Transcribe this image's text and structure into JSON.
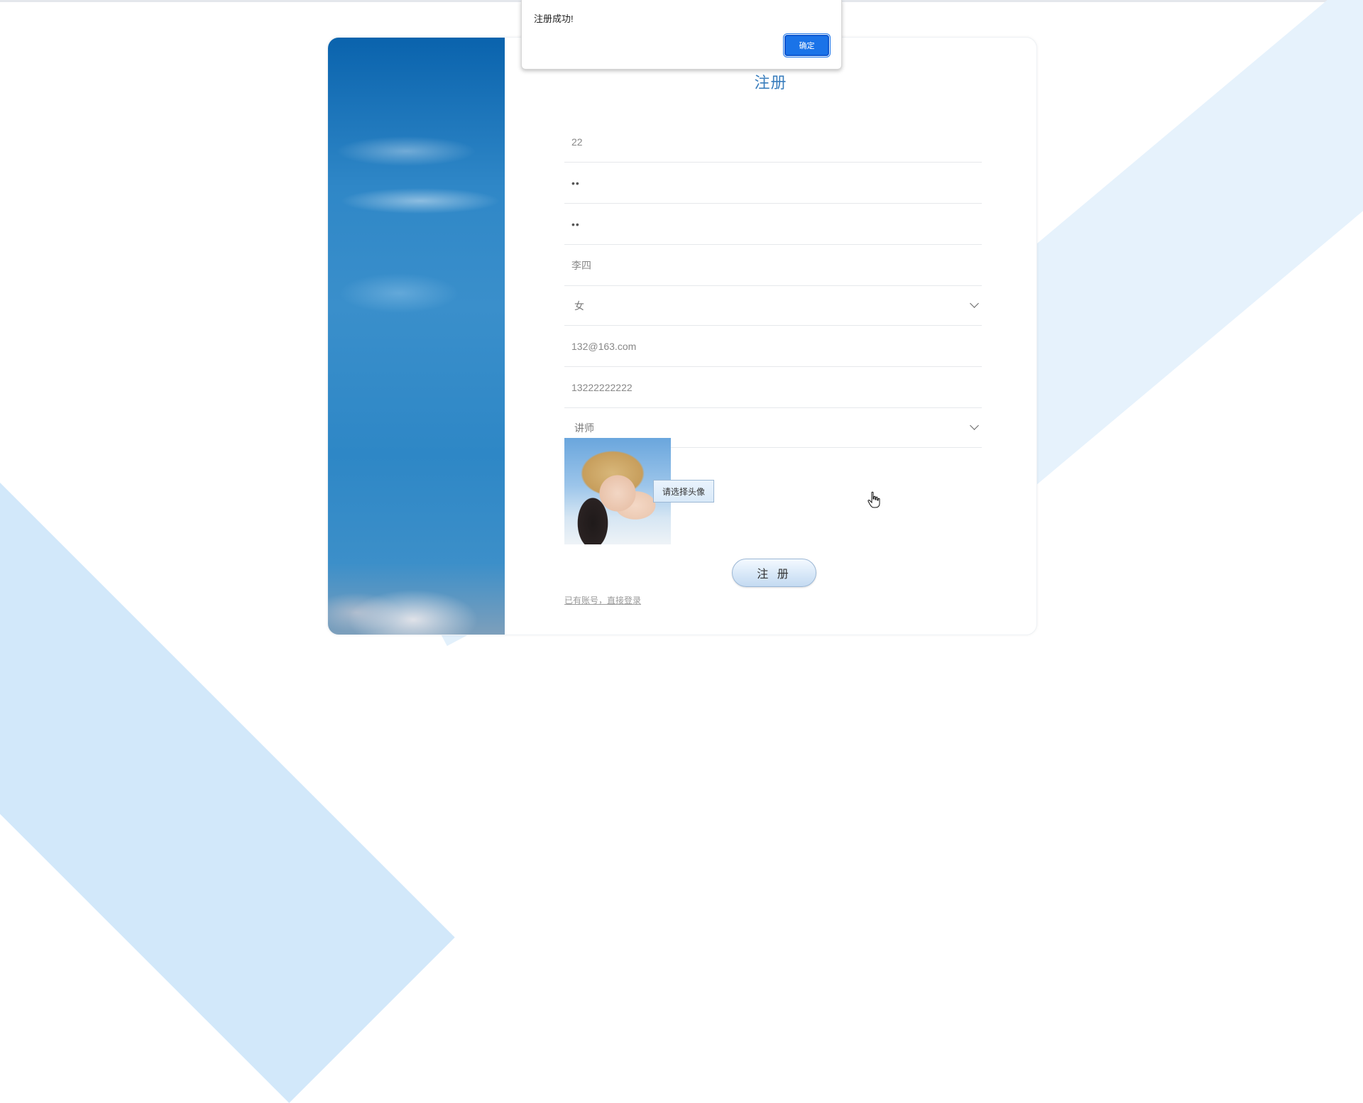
{
  "alert": {
    "message": "注册成功!",
    "ok_label": "确定"
  },
  "form": {
    "title": "注册",
    "username_value": "22",
    "password_value": "••",
    "confirm_password_value": "••",
    "realname_value": "李四",
    "gender": {
      "selected": "女"
    },
    "email_value": "132@163.com",
    "phone_value": "13222222222",
    "role": {
      "selected": "讲师"
    },
    "avatar_button_label": "请选择头像",
    "submit_label": "注 册",
    "login_link": "已有账号，直接登录"
  },
  "colors": {
    "title": "#3a7ebd",
    "primary_button": "#1a73e8",
    "background_stripe": "#d2e8fa"
  },
  "icons": {
    "dropdown": "chevron-down-icon",
    "cursor": "hand-pointer-icon"
  }
}
